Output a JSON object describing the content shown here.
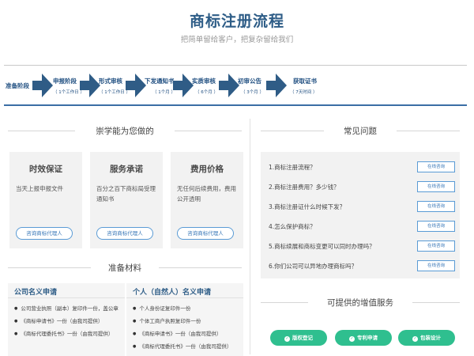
{
  "header": {
    "title": "商标注册流程",
    "subtitle": "把简单留给客户，把复杂留给我们"
  },
  "steps": [
    {
      "title": "准备阶段",
      "sub": ""
    },
    {
      "title": "申报阶段",
      "sub": "（ 1个工作日 ）"
    },
    {
      "title": "形式审核",
      "sub": "（ 1个工作日 ）"
    },
    {
      "title": "下发通知书",
      "sub": "（ 1个月 ）"
    },
    {
      "title": "实质审核",
      "sub": "（ 6个月 ）"
    },
    {
      "title": "初审公告",
      "sub": "（ 3个月 ）"
    },
    {
      "title": "获取证书",
      "sub": "（ 7天时间 ）"
    }
  ],
  "services": {
    "heading": "崇学能为您做的",
    "cards": [
      {
        "title": "时效保证",
        "desc": "当天上报申报文件",
        "button": "咨询商标代理人"
      },
      {
        "title": "服务承诺",
        "desc": "百分之百下商标局受理通知书",
        "button": "咨询商标代理人"
      },
      {
        "title": "费用价格",
        "desc": "无任何后续费用，费用公开透明",
        "button": "咨询商标代理人"
      }
    ]
  },
  "materials": {
    "heading": "准备材料",
    "company": {
      "title": "公司名义申请",
      "items": [
        "公司营业执照（副本）复印件一份，盖公章",
        "《商标申请书》一份（由我司提供）",
        "《商标代理委托书》一份（由我司提供）"
      ]
    },
    "personal": {
      "title": "个人（自然人）名义申请",
      "items": [
        "个人身份证复印件一份",
        "个体工商户执照复印件一份",
        "《商标申请书》一份（由我司提供）",
        "《商标代理委托书》一份（由我司提供）"
      ]
    }
  },
  "faq": {
    "heading": "常见问题",
    "items": [
      {
        "q": "1.商标注册流程？",
        "btn": "在线咨询"
      },
      {
        "q": "2.商标注册费用？多少钱？",
        "btn": "在线咨询"
      },
      {
        "q": "3.商标注册证什么时候下发？",
        "btn": "在线咨询"
      },
      {
        "q": "4.怎么保护商标？",
        "btn": "在线咨询"
      },
      {
        "q": "5.商标续展和商标变更可以同时办理吗？",
        "btn": "在线咨询"
      },
      {
        "q": "6.你们公司可以异地办理商标吗？",
        "btn": "在线咨询"
      }
    ]
  },
  "value_added": {
    "heading": "可提供的增值服务",
    "buttons": [
      "版权登记",
      "专利申请",
      "包装设计"
    ]
  },
  "colors": {
    "title_blue": "#2e5d87",
    "arrow_blue": "#2f5c86",
    "button_green": "#2fbf8f",
    "link_blue": "#3a78b8"
  }
}
